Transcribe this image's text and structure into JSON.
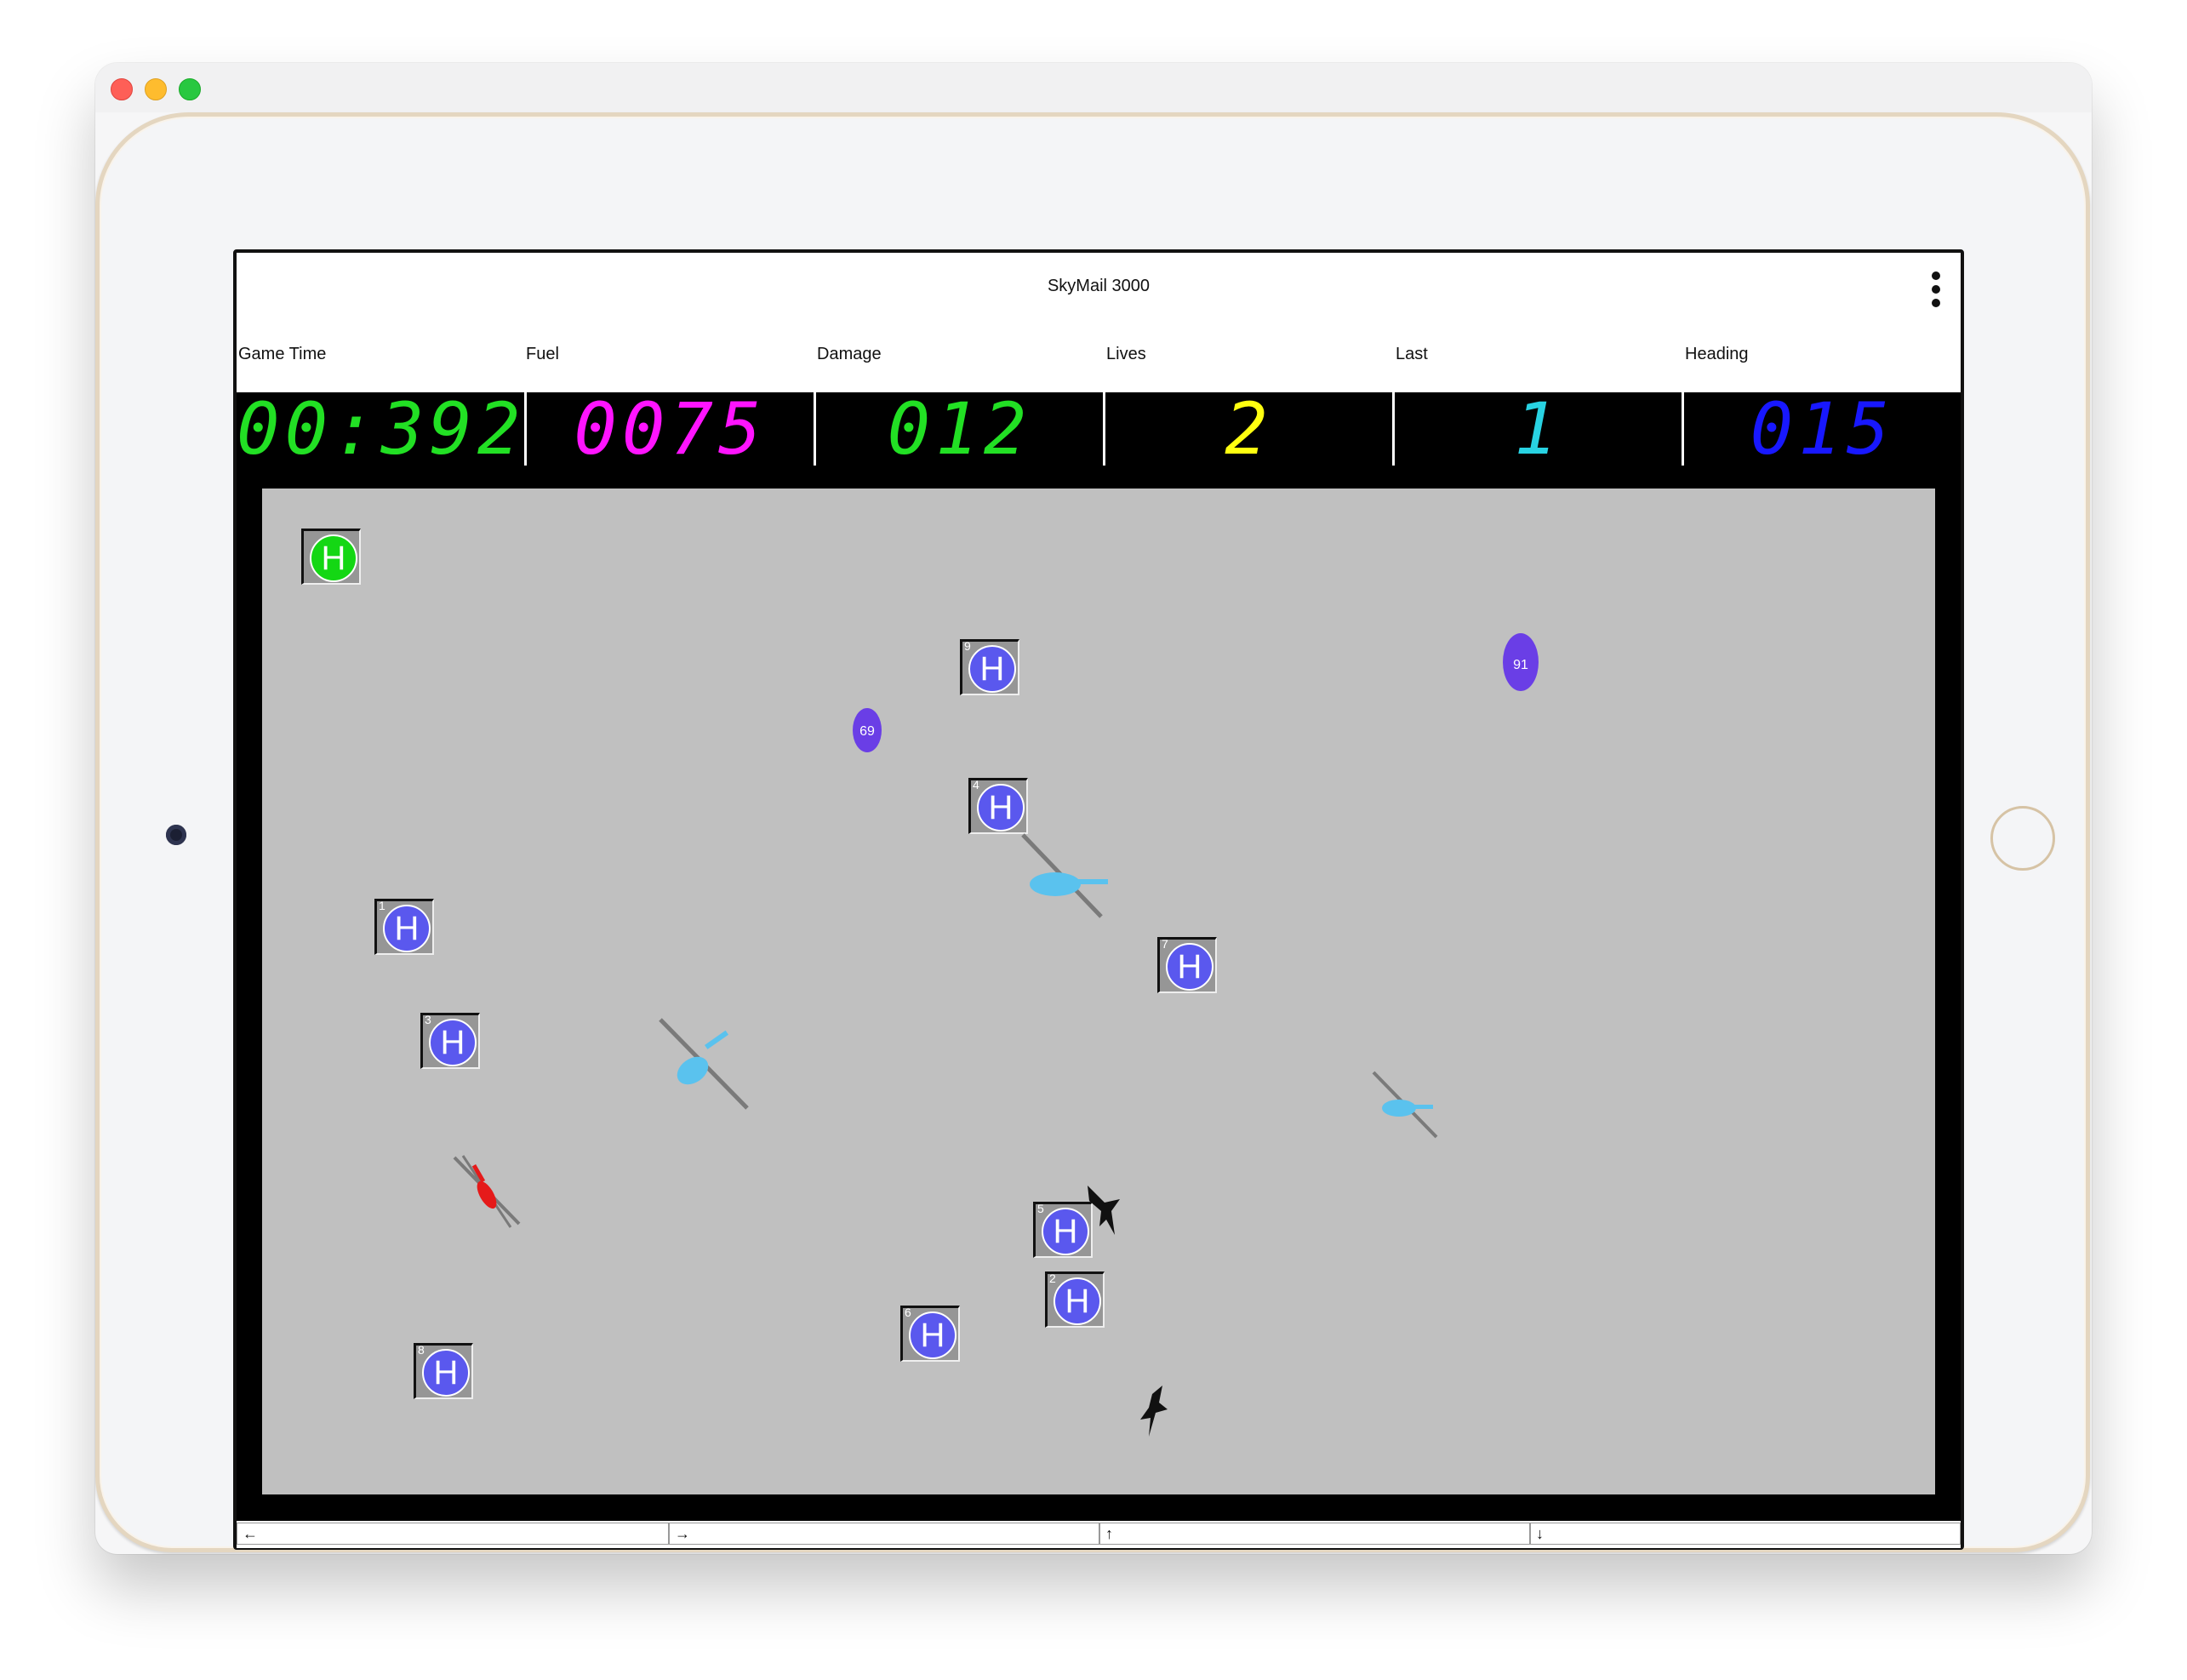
{
  "app": {
    "title": "SkyMail 3000"
  },
  "stats": [
    {
      "label": "Game Time",
      "value": "00:392",
      "color": "#22e024"
    },
    {
      "label": "Fuel",
      "value": "0075",
      "color": "#ff14ff"
    },
    {
      "label": "Damage",
      "value": "012",
      "color": "#22e024"
    },
    {
      "label": "Lives",
      "value": "2",
      "color": "#ffff10"
    },
    {
      "label": "Last",
      "value": "1",
      "color": "#28d2e2"
    },
    {
      "label": "Heading",
      "value": "015",
      "color": "#1818ff"
    }
  ],
  "field": {
    "home_pad": {
      "symbol": "H"
    },
    "pads": [
      {
        "number": "9",
        "symbol": "H"
      },
      {
        "number": "4",
        "symbol": "H"
      },
      {
        "number": "1",
        "symbol": "H"
      },
      {
        "number": "7",
        "symbol": "H"
      },
      {
        "number": "3",
        "symbol": "H"
      },
      {
        "number": "5",
        "symbol": "H"
      },
      {
        "number": "2",
        "symbol": "H"
      },
      {
        "number": "6",
        "symbol": "H"
      },
      {
        "number": "8",
        "symbol": "H"
      }
    ],
    "balloons": [
      {
        "label": "69"
      },
      {
        "label": "91"
      }
    ]
  },
  "controls": [
    {
      "label": "←"
    },
    {
      "label": "→"
    },
    {
      "label": "↑"
    },
    {
      "label": "↓"
    }
  ]
}
